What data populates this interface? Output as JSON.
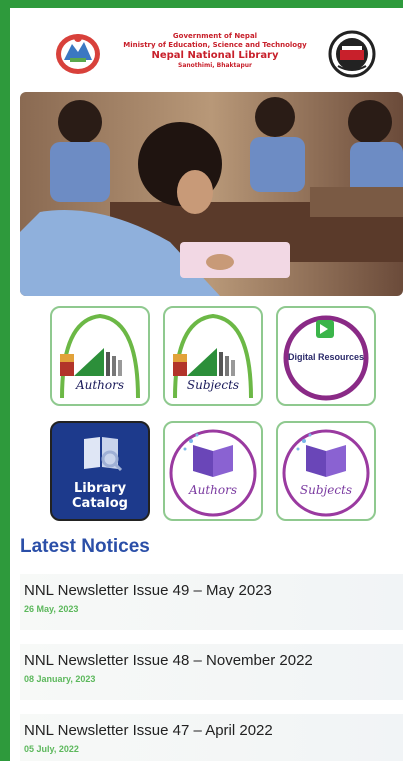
{
  "header": {
    "gov": "Government of Nepal",
    "ministry": "Ministry of Education, Science and Technology",
    "library": "Nepal National Library",
    "location": "Sanothimi, Bhaktapur"
  },
  "tiles": {
    "authors_1": "Authors",
    "subjects_1": "Subjects",
    "digital": "Digital Resources",
    "catalog_line1": "Library",
    "catalog_line2": "Catalog",
    "authors_2": "Authors",
    "subjects_2": "Subjects"
  },
  "notices": {
    "title": "Latest Notices",
    "items": [
      {
        "title": "NNL Newsletter Issue 49 – May 2023",
        "date": "26 May, 2023"
      },
      {
        "title": "NNL Newsletter Issue 48 – November 2022",
        "date": "08 January, 2023"
      },
      {
        "title": "NNL Newsletter Issue 47 – April 2022",
        "date": "05 July, 2022"
      }
    ]
  },
  "colors": {
    "frame_green": "#2e9a3c",
    "header_red": "#c8202b",
    "notice_blue": "#2b4fa8",
    "date_green": "#5cb85c",
    "catalog_blue": "#1d3a8c"
  }
}
